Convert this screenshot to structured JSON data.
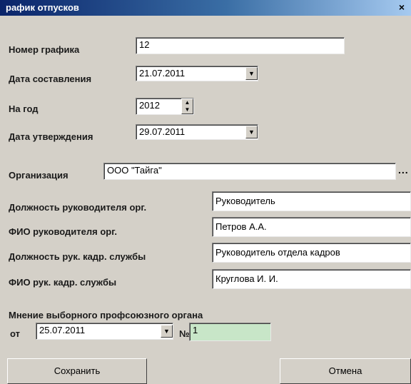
{
  "window": {
    "title": "рафик отпусков",
    "close_glyph": "×"
  },
  "fields": {
    "schedule_number": {
      "label": "Номер графика",
      "value": "12"
    },
    "compile_date": {
      "label": "Дата составления",
      "value": "21.07.2011"
    },
    "for_year": {
      "label": "На год",
      "value": "2012"
    },
    "approval_date": {
      "label": "Дата утверждения",
      "value": "29.07.2011"
    },
    "organization": {
      "label": "Организация",
      "value": "ООО \"Тайга\""
    },
    "head_position": {
      "label": "Должность руководителя орг.",
      "value": "Руководитель"
    },
    "head_name": {
      "label": "ФИО руководителя орг.",
      "value": "Петров А.А."
    },
    "hr_head_position": {
      "label": "Должность рук. кадр. службы",
      "value": "Руководитель отдела кадров"
    },
    "hr_head_name": {
      "label": "ФИО рук. кадр. службы",
      "value": "Круглова И. И."
    }
  },
  "union_opinion": {
    "heading": "Мнение выборного профсоюзного органа",
    "from_label": "от",
    "date": "25.07.2011",
    "number_label": "№",
    "number": "1"
  },
  "buttons": {
    "save": "Сохранить",
    "cancel": "Отмена"
  },
  "icons": {
    "dropdown": "▼",
    "spin_up": "▲",
    "spin_down": "▼",
    "ellipsis": "..."
  }
}
